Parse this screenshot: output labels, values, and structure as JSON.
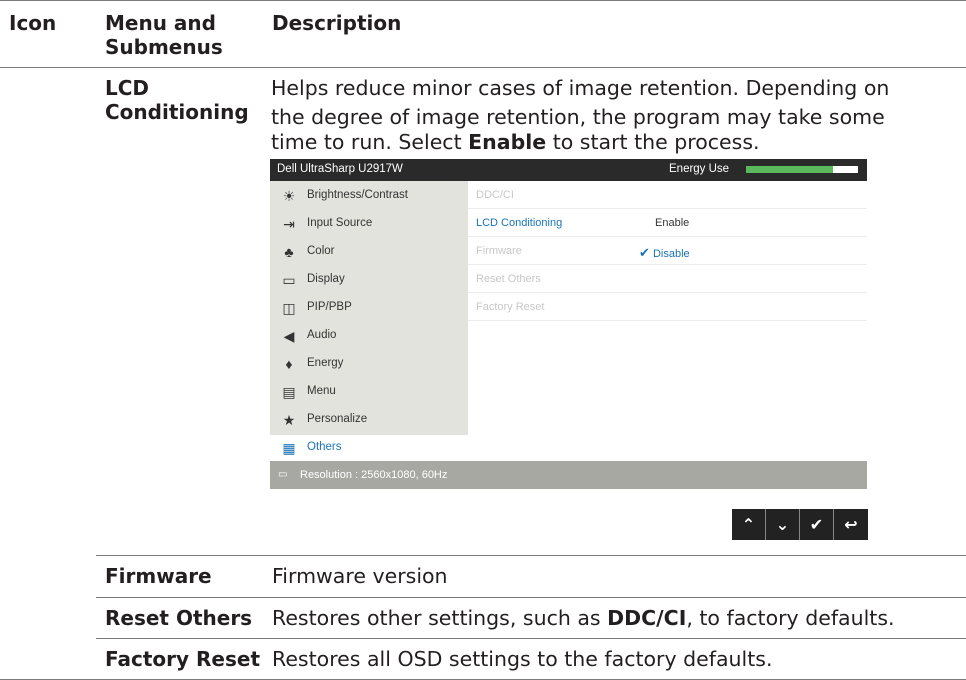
{
  "headers": {
    "icon": "Icon",
    "menu1": "Menu and",
    "menu2": "Submenus",
    "description": "Description"
  },
  "lcd": {
    "term1": "LCD",
    "term2": "Conditioning",
    "line1": "Helps reduce minor cases of image retention. Depending on",
    "line2": "the degree of image retention, the program may take some",
    "line3_pre": "time to run. Select ",
    "line3_bold": "Enable",
    "line3_post": " to start the process."
  },
  "osd": {
    "title": "Dell UltraSharp U2917W",
    "energy_label": "Energy Use",
    "energy_level_percent": 78,
    "menu": [
      {
        "label": "Brightness/Contrast",
        "icon": "brightness-icon",
        "glyph": "☀"
      },
      {
        "label": "Input Source",
        "icon": "input-source-icon",
        "glyph": "⇥"
      },
      {
        "label": "Color",
        "icon": "color-icon",
        "glyph": "♣"
      },
      {
        "label": "Display",
        "icon": "display-icon",
        "glyph": "▭"
      },
      {
        "label": "PIP/PBP",
        "icon": "pip-pbp-icon",
        "glyph": "◫"
      },
      {
        "label": "Audio",
        "icon": "audio-icon",
        "glyph": "◀"
      },
      {
        "label": "Energy",
        "icon": "energy-icon",
        "glyph": "♦"
      },
      {
        "label": "Menu",
        "icon": "menu-icon",
        "glyph": "▤"
      },
      {
        "label": "Personalize",
        "icon": "star-icon",
        "glyph": "★"
      },
      {
        "label": "Others",
        "icon": "others-icon",
        "glyph": "▦"
      }
    ],
    "submenu": [
      "DDC/CI",
      "LCD Conditioning",
      "Firmware",
      "Reset Others",
      "Factory Reset"
    ],
    "option_enable": "Enable",
    "option_disable": "Disable",
    "check_glyph": "✔",
    "footer_icon": "hdmi-icon",
    "resolution": "Resolution : 2560x1080, 60Hz",
    "buttons": [
      {
        "name": "up-button",
        "glyph": "⌃"
      },
      {
        "name": "down-button",
        "glyph": "⌄"
      },
      {
        "name": "confirm-button",
        "glyph": "✔"
      },
      {
        "name": "back-button",
        "glyph": "↩"
      }
    ]
  },
  "rows": [
    {
      "term": "Firmware",
      "desc": "Firmware version"
    },
    {
      "term": "Reset Others",
      "desc_pre": "Restores other settings, such as ",
      "desc_bold": "DDC/CI",
      "desc_post": ", to factory defaults."
    },
    {
      "term": "Factory Reset",
      "desc": "Restores all OSD settings to the factory defaults."
    }
  ]
}
